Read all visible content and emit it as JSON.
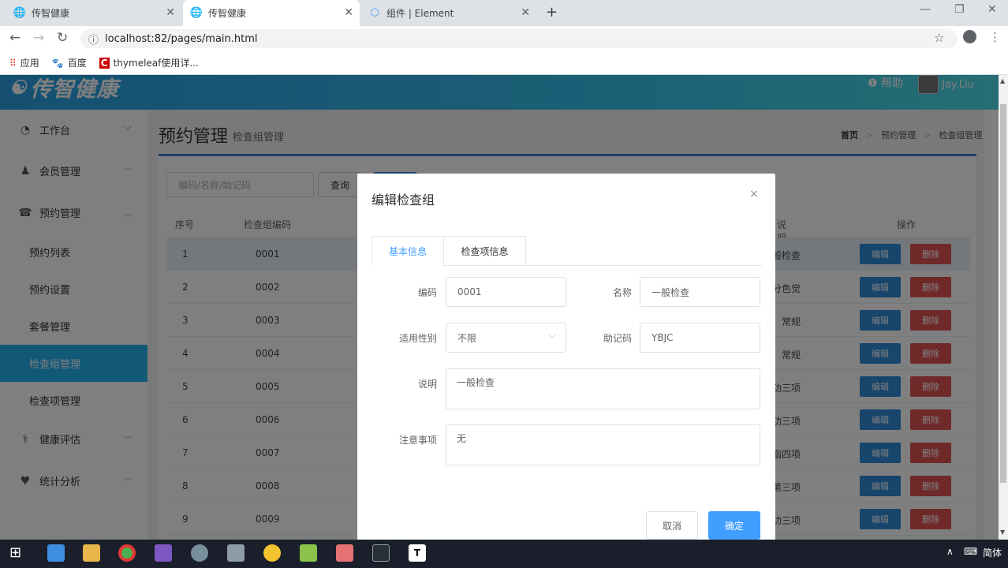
{
  "browser": {
    "tabs": [
      {
        "title": "传智健康",
        "active": false
      },
      {
        "title": "传智健康",
        "active": true
      },
      {
        "title": "组件 | Element",
        "active": false
      }
    ],
    "new_tab": "+",
    "url": "localhost:82/pages/main.html",
    "bookmarks": [
      {
        "label": "应用",
        "icon": "apps-grid-icon"
      },
      {
        "label": "百度",
        "icon": "baidu-paw-icon"
      },
      {
        "label": "thymeleaf使用详...",
        "icon": "bookmark-c-icon"
      }
    ]
  },
  "header": {
    "logo": "传智健康",
    "help": "帮助",
    "user": "Jay.Liu",
    "colors": {
      "start": "#2aa0e5",
      "end": "#4edbe9"
    }
  },
  "sidebar": {
    "items": [
      {
        "label": "工作台",
        "icon": "dashboard-icon",
        "chevron": "﹀"
      },
      {
        "label": "会员管理",
        "icon": "user-icon",
        "chevron": "﹀"
      },
      {
        "label": "预约管理",
        "icon": "phone-icon",
        "chevron": "︿"
      },
      {
        "label": "预约列表"
      },
      {
        "label": "预约设置"
      },
      {
        "label": "套餐管理"
      },
      {
        "label": "检查组管理",
        "active": true
      },
      {
        "label": "检查项管理"
      },
      {
        "label": "健康评估",
        "icon": "stethoscope-icon",
        "chevron": "﹀"
      },
      {
        "label": "统计分析",
        "icon": "heartbeat-icon",
        "chevron": "﹀"
      }
    ]
  },
  "page": {
    "title": "预约管理",
    "subtitle": "检查组管理",
    "breadcrumb": [
      "首页",
      ">",
      "预约管理",
      ">",
      "检查组管理"
    ],
    "search_placeholder": "编码/名称/助记码",
    "query_label": "查询",
    "columns": {
      "index": "序号",
      "code": "检查组编码",
      "desc": "说明",
      "ops": "操作"
    },
    "rows": [
      {
        "index": "1",
        "code": "0001",
        "desc": "般检查"
      },
      {
        "index": "2",
        "code": "0002",
        "desc": "分色觉"
      },
      {
        "index": "3",
        "code": "0003",
        "desc": "常规"
      },
      {
        "index": "4",
        "code": "0004",
        "desc": "常规"
      },
      {
        "index": "5",
        "code": "0005",
        "desc": "功三项"
      },
      {
        "index": "6",
        "code": "0006",
        "desc": "功三项"
      },
      {
        "index": "7",
        "code": "0007",
        "desc": "脂四项"
      },
      {
        "index": "8",
        "code": "0008",
        "desc": "肾第三项"
      },
      {
        "index": "9",
        "code": "0009",
        "desc": "功三项"
      }
    ],
    "edit_label": "编辑",
    "delete_label": "删除"
  },
  "dialog": {
    "title": "编辑检查组",
    "close": "×",
    "tabs": [
      "基本信息",
      "检查项信息"
    ],
    "fields": {
      "code_label": "编码",
      "code_value": "0001",
      "name_label": "名称",
      "name_value": "一般检查",
      "sex_label": "适用性别",
      "sex_value": "不限",
      "helpcode_label": "助记码",
      "helpcode_value": "YBJC",
      "remark_label": "说明",
      "remark_value": "一般检查",
      "attention_label": "注意事项",
      "attention_value": "无"
    },
    "cancel": "取消",
    "confirm": "确定"
  },
  "taskbar": {
    "lang": "简体"
  }
}
